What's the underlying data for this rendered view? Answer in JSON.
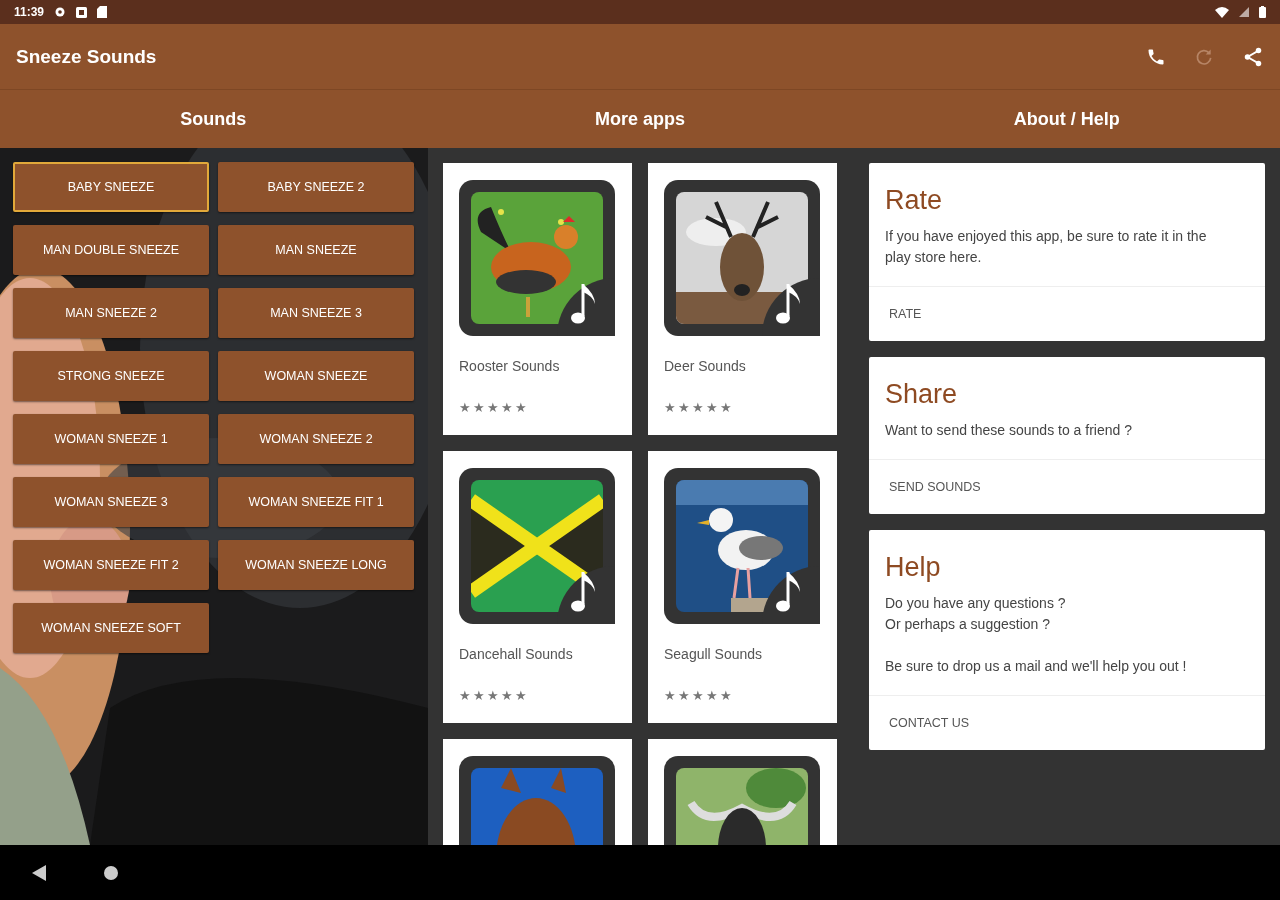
{
  "status_bar": {
    "time": "11:39"
  },
  "app_bar": {
    "title": "Sneeze Sounds"
  },
  "tabs": [
    {
      "label": "Sounds"
    },
    {
      "label": "More apps"
    },
    {
      "label": "About / Help"
    }
  ],
  "sounds": [
    {
      "label": "BABY SNEEZE",
      "selected": true
    },
    {
      "label": "BABY SNEEZE 2",
      "selected": false
    },
    {
      "label": "MAN DOUBLE SNEEZE",
      "selected": false
    },
    {
      "label": "MAN SNEEZE",
      "selected": false
    },
    {
      "label": "MAN SNEEZE 2",
      "selected": false
    },
    {
      "label": "MAN SNEEZE 3",
      "selected": false
    },
    {
      "label": "STRONG SNEEZE",
      "selected": false
    },
    {
      "label": "WOMAN SNEEZE",
      "selected": false
    },
    {
      "label": "WOMAN SNEEZE 1",
      "selected": false
    },
    {
      "label": "WOMAN SNEEZE 2",
      "selected": false
    },
    {
      "label": "WOMAN SNEEZE 3",
      "selected": false
    },
    {
      "label": "WOMAN SNEEZE FIT 1",
      "selected": false
    },
    {
      "label": "WOMAN SNEEZE FIT 2",
      "selected": false
    },
    {
      "label": "WOMAN SNEEZE LONG",
      "selected": false
    },
    {
      "label": "WOMAN SNEEZE SOFT",
      "selected": false
    }
  ],
  "apps": [
    {
      "kind": "rooster",
      "name": "Rooster Sounds",
      "stars": 5
    },
    {
      "kind": "deer",
      "name": "Deer Sounds",
      "stars": 5
    },
    {
      "kind": "flag",
      "name": "Dancehall Sounds",
      "stars": 5
    },
    {
      "kind": "gull",
      "name": "Seagull Sounds",
      "stars": 5
    },
    {
      "kind": "horse"
    },
    {
      "kind": "buffalo"
    }
  ],
  "info_cards": [
    {
      "title": "Rate",
      "paragraphs": [
        [
          "If you have enjoyed this app, be sure to rate it in the play store here."
        ]
      ],
      "action": "RATE"
    },
    {
      "title": "Share",
      "paragraphs": [
        [
          "Want to send these sounds to a friend ?"
        ]
      ],
      "action": "SEND SOUNDS"
    },
    {
      "title": "Help",
      "paragraphs": [
        [
          "Do you have any questions ?",
          "Or perhaps a suggestion ?"
        ],
        [
          "Be sure to drop us a mail and we'll help you out !"
        ]
      ],
      "action": "CONTACT US"
    }
  ]
}
